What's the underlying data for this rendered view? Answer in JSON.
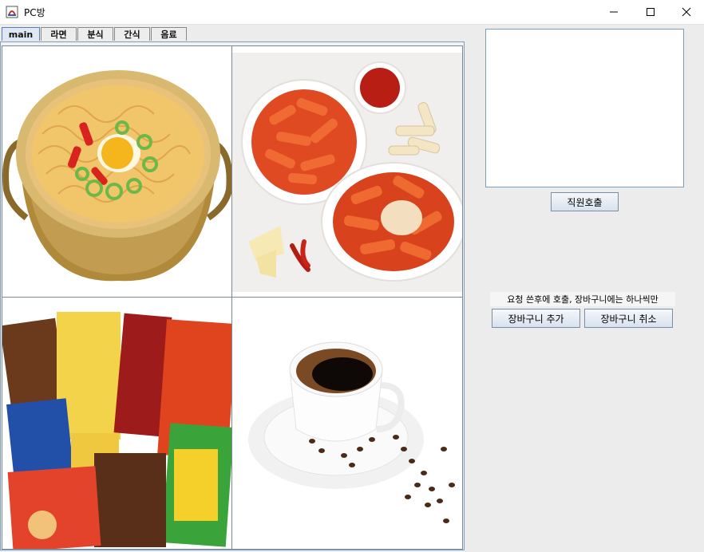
{
  "window": {
    "title": "PC방"
  },
  "tabs": [
    "main",
    "라면",
    "분식",
    "간식",
    "음료"
  ],
  "active_tab": "main",
  "menu_images": [
    {
      "name": "ramen",
      "icon": "ramen-pot-image"
    },
    {
      "name": "tteokbokki",
      "icon": "tteokbokki-image"
    },
    {
      "name": "snacks",
      "icon": "snack-packs-image"
    },
    {
      "name": "coffee",
      "icon": "coffee-cup-image"
    }
  ],
  "controls": {
    "staff_call": "직원호출",
    "note": "요청 쓴후에 호출, 장바구니에는 하나씩만",
    "cart_add": "장바구니 추가",
    "cart_cancel": "장바구니 취소"
  }
}
